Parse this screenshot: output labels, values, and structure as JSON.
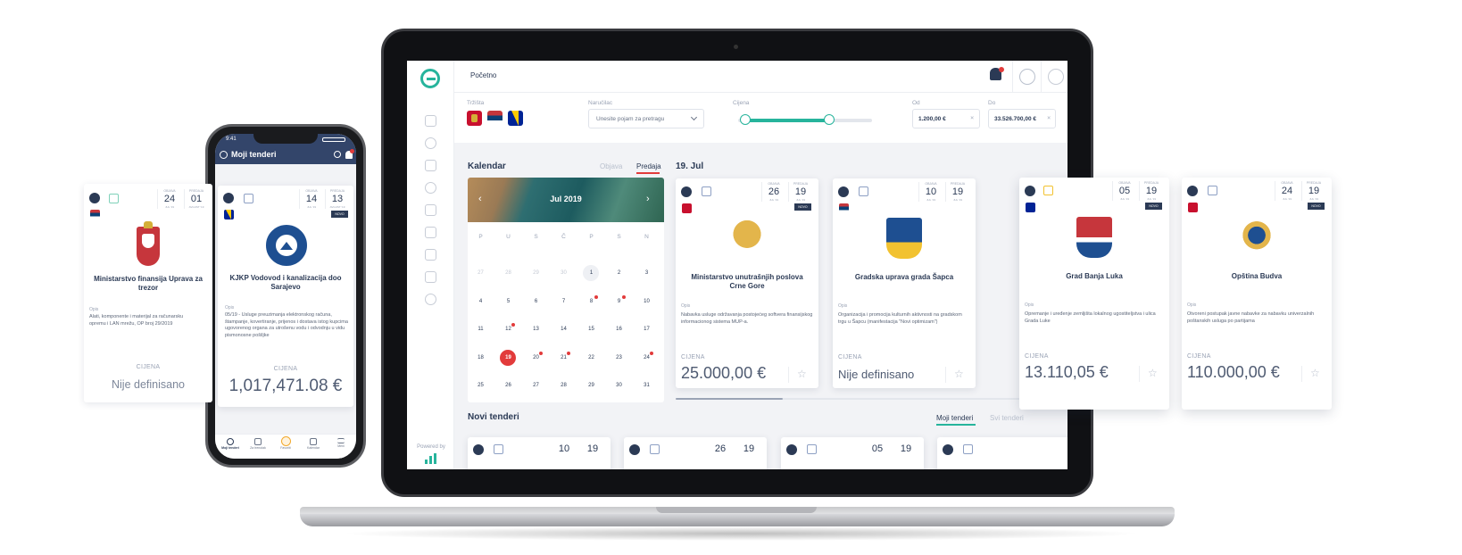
{
  "app": {
    "breadcrumb": "Početno",
    "powered_by": "Powered by"
  },
  "filters": {
    "trzista_label": "Tržišta",
    "narucilac_label": "Naručilac",
    "narucilac_placeholder": "Unesite pojam za pretragu",
    "cijena_label": "Cijena",
    "od_label": "Od",
    "od_value": "1.200,00 €",
    "do_label": "Do",
    "do_value": "33.526.700,00 €",
    "slider_low_fraction": 0.05,
    "slider_high_fraction": 0.68
  },
  "calendar": {
    "title": "Kalendar",
    "tab_objava": "Objava",
    "tab_predaja": "Predaja",
    "month": "Jul 2019",
    "weekdays": [
      "P",
      "U",
      "S",
      "Č",
      "P",
      "S",
      "N"
    ],
    "rows": [
      [
        "27",
        "28",
        "29",
        "30",
        "1",
        "2",
        "3"
      ],
      [
        "4",
        "5",
        "6",
        "7",
        "8",
        "9",
        "10"
      ],
      [
        "11",
        "12",
        "13",
        "14",
        "15",
        "16",
        "17"
      ],
      [
        "18",
        "19",
        "20",
        "21",
        "22",
        "23",
        "24"
      ],
      [
        "25",
        "26",
        "27",
        "28",
        "29",
        "30",
        "31"
      ]
    ]
  },
  "selected_date": "19. Jul",
  "cards": [
    {
      "day1": "26",
      "day2": "19",
      "name": "Ministarstvo unutrašnjih poslova Crne Gore",
      "opis": "Opis",
      "desc": "Nabavka usluge održavanja postojećeg softvera finansijskog informacionog sistema MUP-a.",
      "cijena": "CIJENA",
      "price": "25.000,00 €",
      "badge": "NOVO"
    },
    {
      "day1": "10",
      "day2": "19",
      "name": "Gradska uprava grada Šapca",
      "opis": "Opis",
      "desc": "Organizacija i promocija kulturnih aktivnosti na gradskom trgu u Šapcu (manifestacija \"Novi optimizam\")",
      "cijena": "CIJENA",
      "price": "Nije definisano",
      "badge": ""
    },
    {
      "day1": "05",
      "day2": "19",
      "name": "Grad Banja Luka",
      "opis": "Opis",
      "desc": "Opremanje i uređenje zemljišta lokalnog ugostiteljstva i ulica Grada Luke",
      "cijena": "CIJENA",
      "price": "13.110,05 €",
      "badge": "NOVO"
    },
    {
      "day1": "24",
      "day2": "19",
      "name": "Opština Budva",
      "opis": "Opis",
      "desc": "Otvoreni postupak javne nabavke za nabavku univerzalnih poštanskih usluga po partijama",
      "cijena": "CIJENA",
      "price": "110.000,00 €",
      "badge": "NOVO"
    }
  ],
  "novi": {
    "title": "Novi tenderi",
    "tab_moji": "Moji tenderi",
    "tab_svi": "Svi tenderi",
    "dates": [
      [
        "10",
        "19"
      ],
      [
        "26",
        "19"
      ],
      [
        "05",
        "19"
      ]
    ]
  },
  "phone": {
    "time": "9:41",
    "title": "Moji tenderi",
    "card_left": {
      "day1": "24",
      "day2": "01",
      "name": "Ministarstvo finansija Uprava za trezor",
      "opis": "Opis",
      "desc": "Alati, komponente i materijal za računarsku opremu i LAN mrežu, OP broj 29/2019",
      "cijena": "CIJENA",
      "price": "Nije definisano"
    },
    "card_main": {
      "day1": "14",
      "day2": "13",
      "badge": "NOVO",
      "name": "KJKP Vodovod i kanalizacija doo Sarajevo",
      "opis": "Opis",
      "desc": "05/19 - Usluge preuzimanja elektronskog računa, štampanje, kovertiranje, prijenos i dostava istog kupcima ugovorenog organa za utrošenu vodu i odvodnju u vidu pismonosne pošiljke",
      "cijena": "CIJENA",
      "price": "1,017,471.08 €"
    },
    "nav": [
      "Moji tenderi",
      "Za trenutak",
      "Favoriti",
      "Kalendar",
      "Meni"
    ]
  },
  "colors": {
    "accent": "#27b49c",
    "navy": "#2b3a55",
    "alert": "#e23b3b"
  }
}
